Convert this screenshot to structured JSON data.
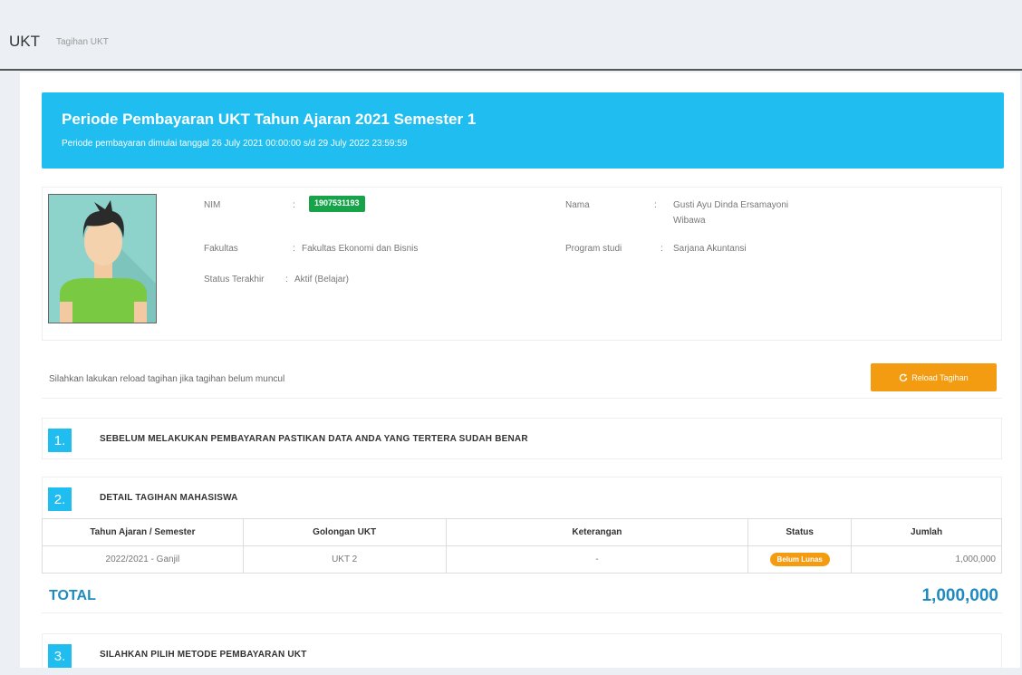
{
  "header": {
    "title": "UKT",
    "subtitle": "Tagihan UKT"
  },
  "banner": {
    "title": "Periode Pembayaran UKT Tahun Ajaran 2021 Semester 1",
    "subtitle": "Periode pembayaran dimulai tanggal 26 July 2021 00:00:00 s/d 29 July 2022 23:59:59"
  },
  "profile": {
    "nim_label": "NIM",
    "nim_value": "1907531193",
    "nama_label": "Nama",
    "nama_value_line1": "Gusti Ayu Dinda Ersamayoni",
    "nama_value_line2": "Wibawa",
    "fakultas_label": "Fakultas",
    "fakultas_value": "Fakultas Ekonomi dan Bisnis",
    "prodi_label": "Program studi",
    "prodi_value": "Sarjana Akuntansi",
    "status_label": "Status Terakhir",
    "status_value": "Aktif (Belajar)",
    "colon": ":"
  },
  "reload": {
    "message": "Silahkan lakukan reload tagihan jika tagihan belum muncul",
    "button_label": "Reload Tagihan",
    "button_icon": "refresh-icon"
  },
  "steps": [
    {
      "num": "1.",
      "title": "SEBELUM MELAKUKAN PEMBAYARAN PASTIKAN DATA ANDA YANG TERTERA SUDAH BENAR"
    },
    {
      "num": "2.",
      "title": "DETAIL TAGIHAN MAHASISWA"
    },
    {
      "num": "3.",
      "title": "SILAHKAN PILIH METODE PEMBAYARAN UKT"
    }
  ],
  "table": {
    "headers": [
      "Tahun Ajaran / Semester",
      "Golongan UKT",
      "Keterangan",
      "Status",
      "Jumlah"
    ],
    "rows": [
      {
        "tahun": "2022/2021 - Ganjil",
        "golongan": "UKT 2",
        "keterangan": "-",
        "status": "Belum Lunas",
        "jumlah": "1,000,000"
      }
    ]
  },
  "total": {
    "label": "TOTAL",
    "value": "1,000,000"
  },
  "colors": {
    "accent": "#1fbdf0",
    "warning": "#f39c12",
    "success": "#16a34a",
    "total_text": "#1f8ac0"
  }
}
